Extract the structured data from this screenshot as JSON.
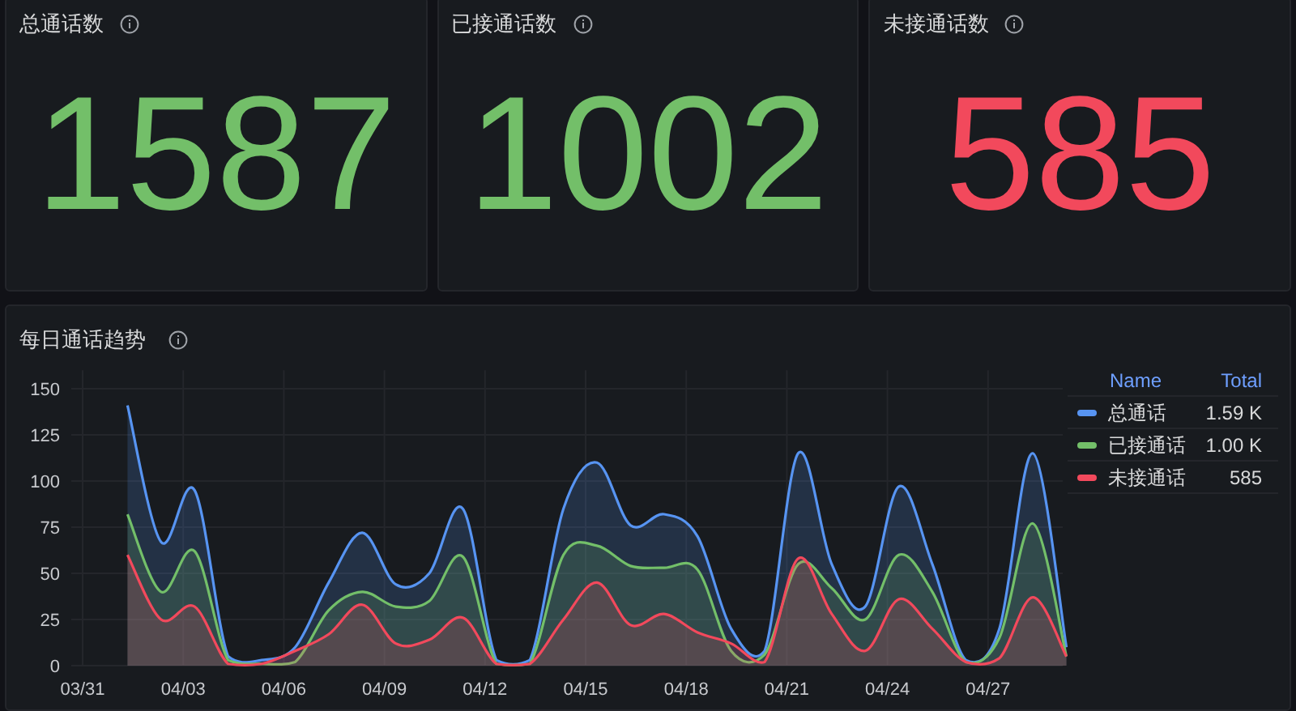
{
  "stats": [
    {
      "title": "总通话数",
      "value": "1587",
      "color": "#73bf69"
    },
    {
      "title": "已接通话数",
      "value": "1002",
      "color": "#73bf69"
    },
    {
      "title": "未接通话数",
      "value": "585",
      "color": "#f2495c"
    }
  ],
  "trend": {
    "title": "每日通话趋势",
    "chart_data": {
      "type": "area",
      "categories": [
        "03/31",
        null,
        null,
        "04/03",
        null,
        null,
        "04/06",
        null,
        null,
        "04/09",
        null,
        null,
        "04/12",
        null,
        null,
        "04/15",
        null,
        null,
        "04/18",
        null,
        null,
        "04/21",
        null,
        null,
        "04/24",
        null,
        null,
        "04/27",
        null,
        null
      ],
      "series": [
        {
          "name": "总通话",
          "color": "#5794f2",
          "values": [
            null,
            141,
            67,
            95,
            5,
            3,
            10,
            45,
            72,
            44,
            50,
            85,
            3,
            3,
            85,
            110,
            76,
            82,
            70,
            20,
            8,
            115,
            55,
            32,
            97,
            55,
            3,
            20,
            115,
            10
          ]
        },
        {
          "name": "已接通话",
          "color": "#73bf69",
          "values": [
            null,
            82,
            40,
            62,
            3,
            1,
            2,
            30,
            40,
            32,
            35,
            59,
            1,
            1,
            60,
            65,
            54,
            53,
            52,
            8,
            6,
            55,
            42,
            25,
            60,
            40,
            2,
            15,
            77,
            5
          ]
        },
        {
          "name": "未接通话",
          "color": "#f2495c",
          "values": [
            null,
            60,
            25,
            32,
            1,
            1,
            8,
            17,
            33,
            12,
            14,
            26,
            1,
            1,
            25,
            45,
            22,
            28,
            18,
            12,
            2,
            58,
            28,
            8,
            36,
            20,
            2,
            4,
            37,
            5
          ]
        }
      ],
      "ylim": [
        0,
        160
      ],
      "grid": true,
      "yticks": [
        0,
        25,
        50,
        75,
        100,
        125,
        150
      ]
    },
    "legend": {
      "columns": [
        "Name",
        "Total"
      ],
      "totals": [
        "1.59 K",
        "1.00 K",
        "585"
      ]
    }
  }
}
